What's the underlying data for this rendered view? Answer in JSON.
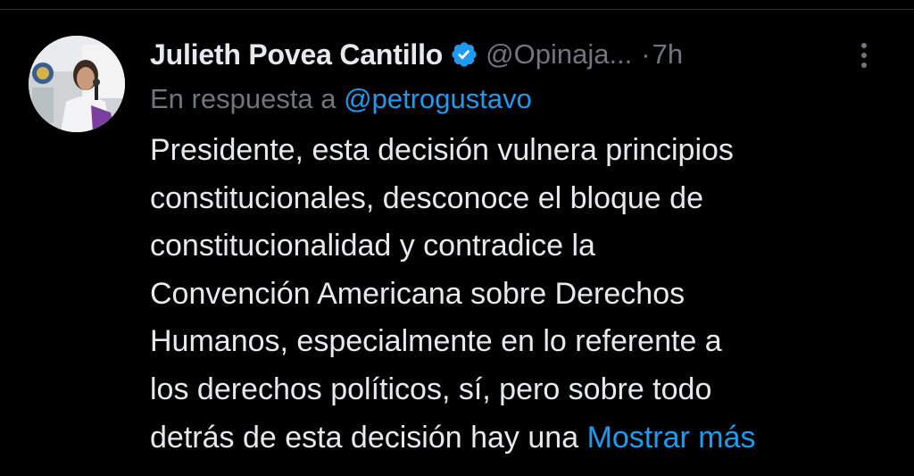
{
  "tweet": {
    "author_name": "Julieth Povea Cantillo",
    "handle": "@Opinaja...",
    "dot": "·",
    "time": "7h",
    "verified_icon": "verified-badge-icon",
    "more_icon": "more-vertical-icon",
    "reply_prefix": "En respuesta a",
    "reply_mention": "@petrogustavo",
    "text_lines": [
      "Presidente, esta decisión vulnera principios",
      "constitucionales, desconoce el bloque de",
      "constitucionalidad y contradice la",
      "Convención Americana sobre Derechos",
      "Humanos, especialmente en lo referente a",
      "los derechos políticos, sí, pero sobre todo",
      "detrás de esta decisión hay una"
    ],
    "show_more_label": "Mostrar más"
  },
  "colors": {
    "background": "#000000",
    "text": "#e7e9ea",
    "secondary": "#71767b",
    "accent": "#1d9bf0"
  }
}
